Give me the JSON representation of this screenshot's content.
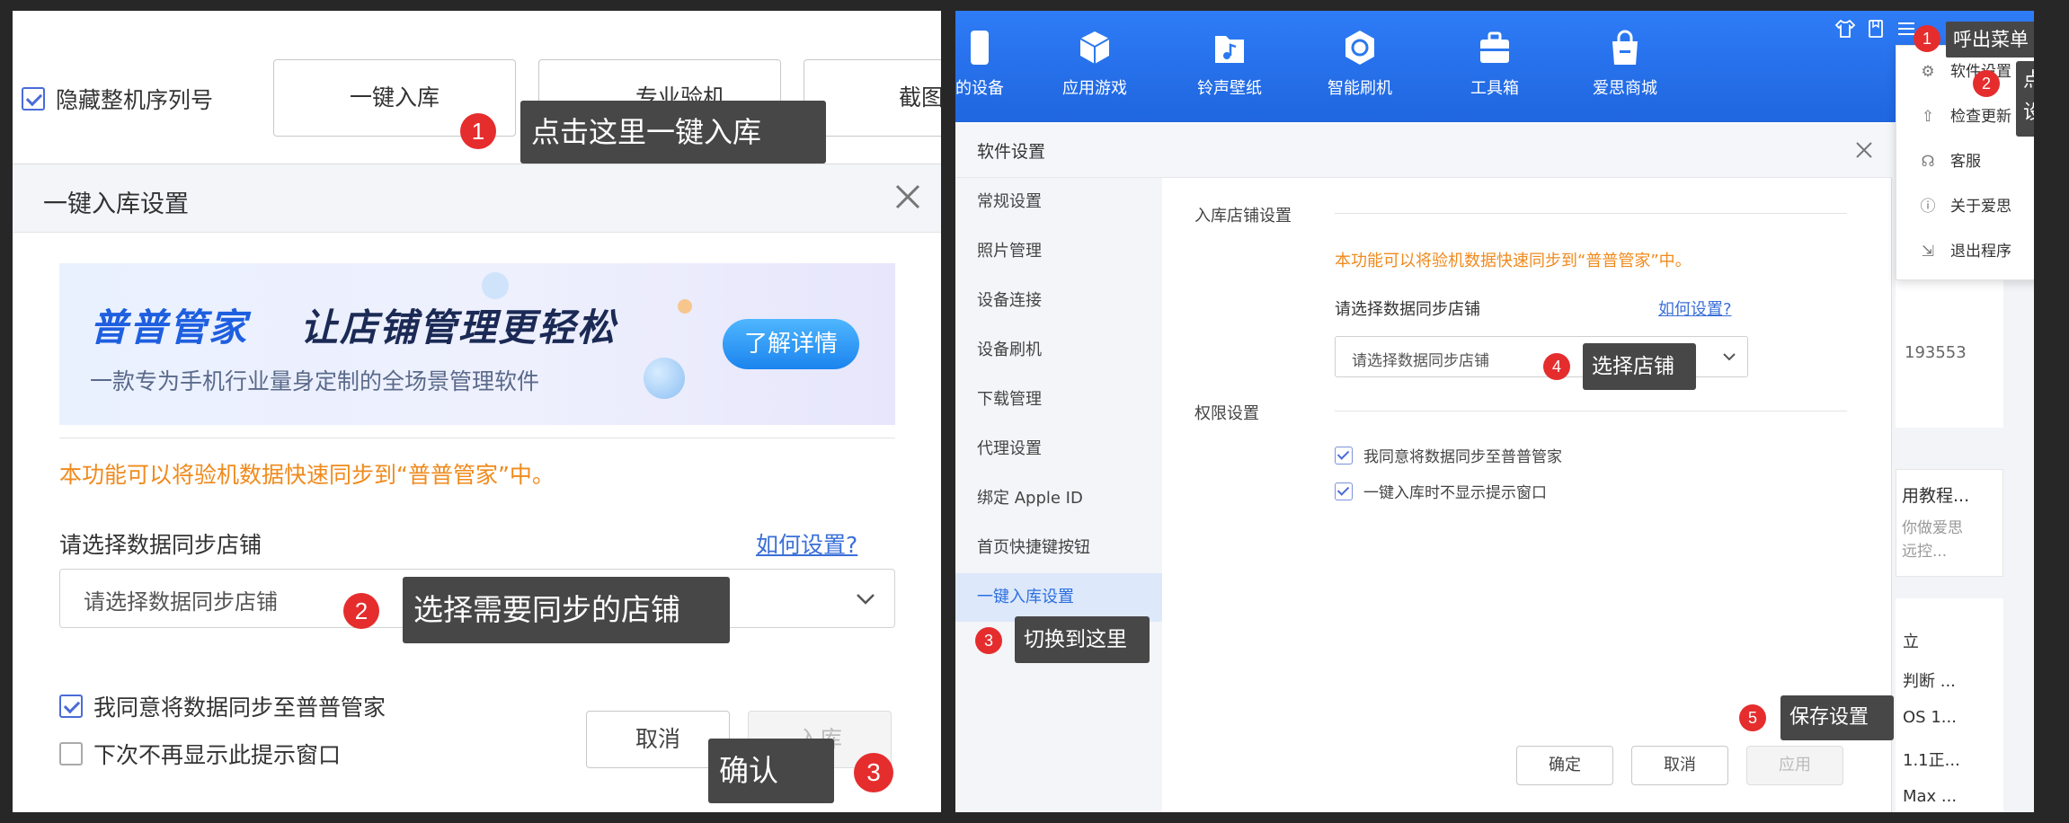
{
  "left": {
    "top_bar": {
      "hide_serial_label": "隐藏整机序列号",
      "one_click_button": "一键入库",
      "pro_inspect_button": "专业验机",
      "screenshot_button": "截图"
    },
    "dialog": {
      "title": "一键入库设置",
      "banner": {
        "brand": "普普管家",
        "headline": "让店铺管理更轻松",
        "subtitle": "一款专为手机行业量身定制的全场景管理软件",
        "cta": "了解详情"
      },
      "notice": "本功能可以将验机数据快速同步到“普普管家”中。",
      "store_label": "请选择数据同步店铺",
      "help_link": "如何设置?",
      "select_placeholder": "请选择数据同步店铺",
      "agree_checkbox": "我同意将数据同步至普普管家",
      "no_remind_checkbox": "下次不再显示此提示窗口",
      "cancel_button": "取消",
      "confirm_button": "入库"
    },
    "callouts": {
      "c1": {
        "num": "1",
        "text": "点击这里一键入库"
      },
      "c2": {
        "num": "2",
        "text": "选择需要同步的店铺"
      },
      "c3": {
        "num": "3",
        "text": "确认"
      }
    }
  },
  "right": {
    "nav": [
      "的设备",
      "应用游戏",
      "铃声壁纸",
      "智能刷机",
      "工具箱",
      "爱思商城"
    ],
    "menu": {
      "items": [
        "软件设置",
        "检查更新",
        "客服",
        "关于爱思",
        "退出程序"
      ]
    },
    "dialog": {
      "title": "软件设置",
      "sidebar": [
        "常规设置",
        "照片管理",
        "设备连接",
        "设备刷机",
        "下载管理",
        "代理设置",
        "绑定 Apple ID",
        "首页快捷键按钮",
        "一键入库设置"
      ],
      "section_store": "入库店铺设置",
      "notice": "本功能可以将验机数据快速同步到“普普管家”中。",
      "store_label": "请选择数据同步店铺",
      "help_link": "如何设置?",
      "select_placeholder": "请选择数据同步店铺",
      "section_perm": "权限设置",
      "agree_checkbox": "我同意将数据同步至普普管家",
      "no_prompt_checkbox": "一键入库时不显示提示窗口",
      "ok_button": "确定",
      "cancel_button": "取消",
      "apply_button": "应用"
    },
    "background_fragments": {
      "serial": "193553",
      "card_title": "用教程...",
      "card_l1": "你做爱思",
      "card_l2": "远控...",
      "list": [
        "立",
        "判断 ...",
        "OS 1...",
        "1.1正...",
        "Max ..."
      ]
    },
    "callouts": {
      "c1": {
        "num": "1",
        "text": "呼出菜单"
      },
      "c2": {
        "num": "2",
        "text": "点击",
        "text2": "设置"
      },
      "c3": {
        "num": "3",
        "text": "切换到这里"
      },
      "c4": {
        "num": "4",
        "text": "选择店铺"
      },
      "c5": {
        "num": "5",
        "text": "保存设置"
      }
    }
  },
  "colors": {
    "accent_orange": "#f08a1c",
    "nav_blue": "#2b78f0",
    "badge_red": "#e52d2d",
    "callout_gray": "#474747",
    "link_blue": "#3a6fd8"
  }
}
